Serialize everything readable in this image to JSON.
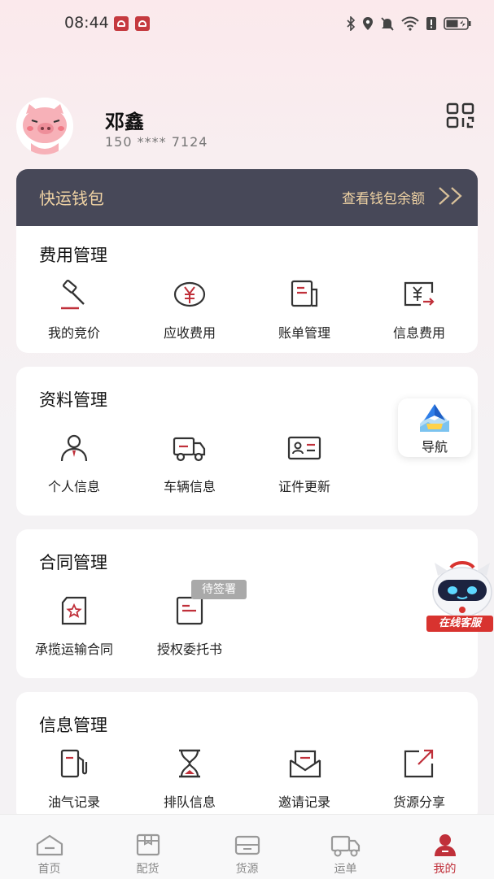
{
  "status_bar": {
    "time": "08:44"
  },
  "profile": {
    "name": "邓鑫",
    "phone": "150 **** 7124"
  },
  "wallet": {
    "title": "快运钱包",
    "link": "查看钱包余额"
  },
  "fee_section": {
    "title": "费用管理",
    "items": [
      "我的竞价",
      "应收费用",
      "账单管理",
      "信息费用"
    ]
  },
  "data_section": {
    "title": "资料管理",
    "items": [
      "个人信息",
      "车辆信息",
      "证件更新"
    ]
  },
  "contract_section": {
    "title": "合同管理",
    "items": [
      "承揽运输合同",
      "授权委托书"
    ],
    "badge": "待签署"
  },
  "info_section": {
    "title": "信息管理",
    "items": [
      "油气记录",
      "排队信息",
      "邀请记录",
      "货源分享"
    ]
  },
  "floating_nav": {
    "label": "导航"
  },
  "online_service": {
    "label": "在线客服"
  },
  "tabbar": {
    "tabs": [
      "首页",
      "配货",
      "货源",
      "运单",
      "我的"
    ],
    "active": "我的"
  },
  "colors": {
    "accent": "#c0303a",
    "wallet_bg": "#474858",
    "wallet_text": "#f0d3a4"
  }
}
